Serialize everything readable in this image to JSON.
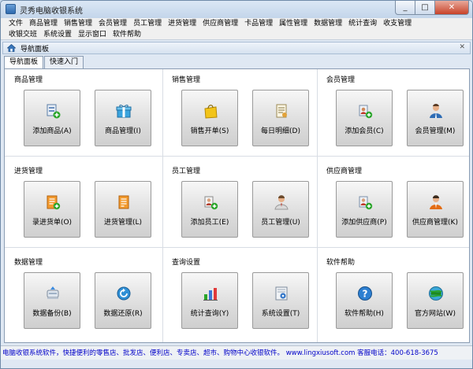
{
  "window": {
    "title": "灵秀电脑收银系统",
    "close_glyph": "✕",
    "max_glyph": "□",
    "min_glyph": "_"
  },
  "menu": {
    "row1": [
      "文件",
      "商品管理",
      "销售管理",
      "会员管理",
      "员工管理",
      "进货管理",
      "供应商管理",
      "卡品管理",
      "属性管理",
      "数据管理",
      "统计查询",
      "收支管理"
    ],
    "row2": [
      "收银交班",
      "系统设置",
      "显示窗口",
      "软件帮助"
    ]
  },
  "panel": {
    "title": "导航面板",
    "close_glyph": "✕"
  },
  "tabs": [
    "导航面板",
    "快速入门"
  ],
  "groups": [
    {
      "title": "商品管理",
      "buttons": [
        {
          "label": "添加商品(A)",
          "icon": "add-product-icon"
        },
        {
          "label": "商品管理(I)",
          "icon": "gift-icon"
        }
      ]
    },
    {
      "title": "销售管理",
      "buttons": [
        {
          "label": "销售开单(S)",
          "icon": "shopping-bag-icon"
        },
        {
          "label": "每日明细(D)",
          "icon": "daily-detail-icon"
        }
      ]
    },
    {
      "title": "会员管理",
      "buttons": [
        {
          "label": "添加会员(C)",
          "icon": "add-member-icon"
        },
        {
          "label": "会员管理(M)",
          "icon": "member-icon"
        }
      ]
    },
    {
      "title": "进货管理",
      "buttons": [
        {
          "label": "录进货单(O)",
          "icon": "purchase-form-icon"
        },
        {
          "label": "进货管理(L)",
          "icon": "purchase-list-icon"
        }
      ]
    },
    {
      "title": "员工管理",
      "buttons": [
        {
          "label": "添加员工(E)",
          "icon": "add-employee-icon"
        },
        {
          "label": "员工管理(U)",
          "icon": "employee-icon"
        }
      ]
    },
    {
      "title": "供应商管理",
      "buttons": [
        {
          "label": "添加供应商(P)",
          "icon": "add-supplier-icon"
        },
        {
          "label": "供应商管理(K)",
          "icon": "supplier-icon"
        }
      ]
    },
    {
      "title": "数据管理",
      "buttons": [
        {
          "label": "数据备份(B)",
          "icon": "backup-icon"
        },
        {
          "label": "数据还原(R)",
          "icon": "restore-icon"
        }
      ]
    },
    {
      "title": "查询设置",
      "buttons": [
        {
          "label": "统计查询(Y)",
          "icon": "chart-icon"
        },
        {
          "label": "系统设置(T)",
          "icon": "settings-icon"
        }
      ]
    },
    {
      "title": "软件帮助",
      "buttons": [
        {
          "label": "软件帮助(H)",
          "icon": "help-icon"
        },
        {
          "label": "官方网站(W)",
          "icon": "website-icon"
        }
      ]
    }
  ],
  "status": {
    "text": "电脑收银系统软件，快捷便利的零售店、批发店、便利店、专卖店、超市、购物中心收银软件。   www.lingxiusoft.com   客服电话：400-618-3675"
  },
  "colors": {
    "accent": "#2d69ad",
    "status_text": "#0000c8"
  }
}
